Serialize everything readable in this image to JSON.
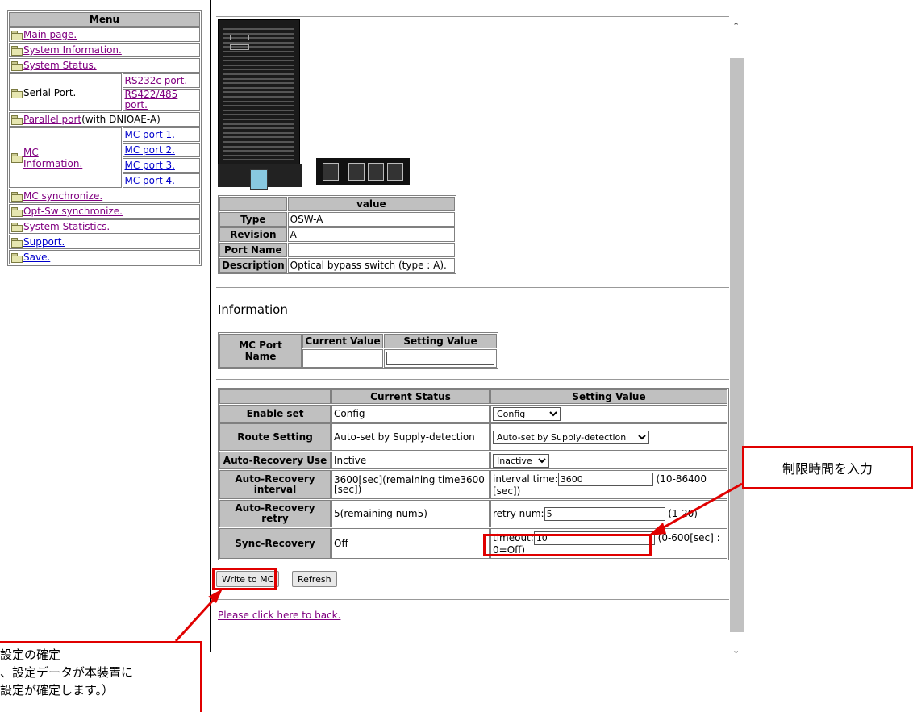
{
  "menu": {
    "title": "Menu",
    "items": {
      "main_page": "Main page.",
      "system_information": "System Information.",
      "system_status": "System Status.",
      "serial_port": "Serial Port.",
      "rs232c": "RS232c port.",
      "rs422_485_line1": "RS422/485",
      "rs422_485_line2": "port.",
      "parallel_port": "Parallel port",
      "parallel_note": "(with DNIOAE-A)",
      "mc_information_line1": "MC",
      "mc_information_line2": "Information.",
      "mc_ports": [
        "MC port 1.",
        "MC port 2.",
        "MC port 3.",
        "MC port 4."
      ],
      "mc_synchronize": "MC synchronize.",
      "opt_sw_synchronize": "Opt-Sw synchronize.",
      "system_statistics": "System Statistics.",
      "support": "Support.",
      "save": "Save."
    }
  },
  "device_table": {
    "value_header": "value",
    "rows": [
      {
        "label": "Type",
        "value": "OSW-A"
      },
      {
        "label": "Revision",
        "value": "A"
      },
      {
        "label": "Port Name",
        "value": ""
      },
      {
        "label": "Description",
        "value": "Optical bypass switch (type : A)."
      }
    ]
  },
  "information": {
    "title": "Information",
    "mc_port_name": "MC Port Name",
    "current_value": "Current Value",
    "setting_value": "Setting Value"
  },
  "settings": {
    "headers": {
      "current_status": "Current Status",
      "setting_value": "Setting Value"
    },
    "enable_set": {
      "label": "Enable set",
      "current": "Config",
      "select": "Config"
    },
    "route_setting": {
      "label": "Route Setting",
      "current": "Auto-set by Supply-detection",
      "select": "Auto-set by Supply-detection"
    },
    "auto_recovery_use": {
      "label": "Auto-Recovery Use",
      "current": "Inctive",
      "select": "Inactive"
    },
    "auto_recovery_interval": {
      "label": "Auto-Recovery interval",
      "current": "3600[sec](remaining time3600 [sec])",
      "prefix": "interval time:",
      "value": "3600",
      "range": "(10-86400 [sec])"
    },
    "auto_recovery_retry": {
      "label": "Auto-Recovery retry",
      "current": "5(remaining num5)",
      "prefix": "retry num:",
      "value": "5",
      "range": "(1-20)"
    },
    "sync_recovery": {
      "label": "Sync-Recovery",
      "current": "Off",
      "prefix": "timeout:",
      "value": "10",
      "range": "(0-600[sec] : 0=Off)"
    }
  },
  "buttons": {
    "write": "Write to MC",
    "refresh": "Refresh"
  },
  "back_link": "Please click here to back.",
  "callouts": {
    "limit_time": "制限時間を入力",
    "confirm_line1": "設定の確定",
    "confirm_line2": "、設定データが本装置に",
    "confirm_line3": "設定が確定します。）"
  },
  "colors": {
    "accent_red": "#e00000",
    "header_gray": "#c0c0c0"
  }
}
